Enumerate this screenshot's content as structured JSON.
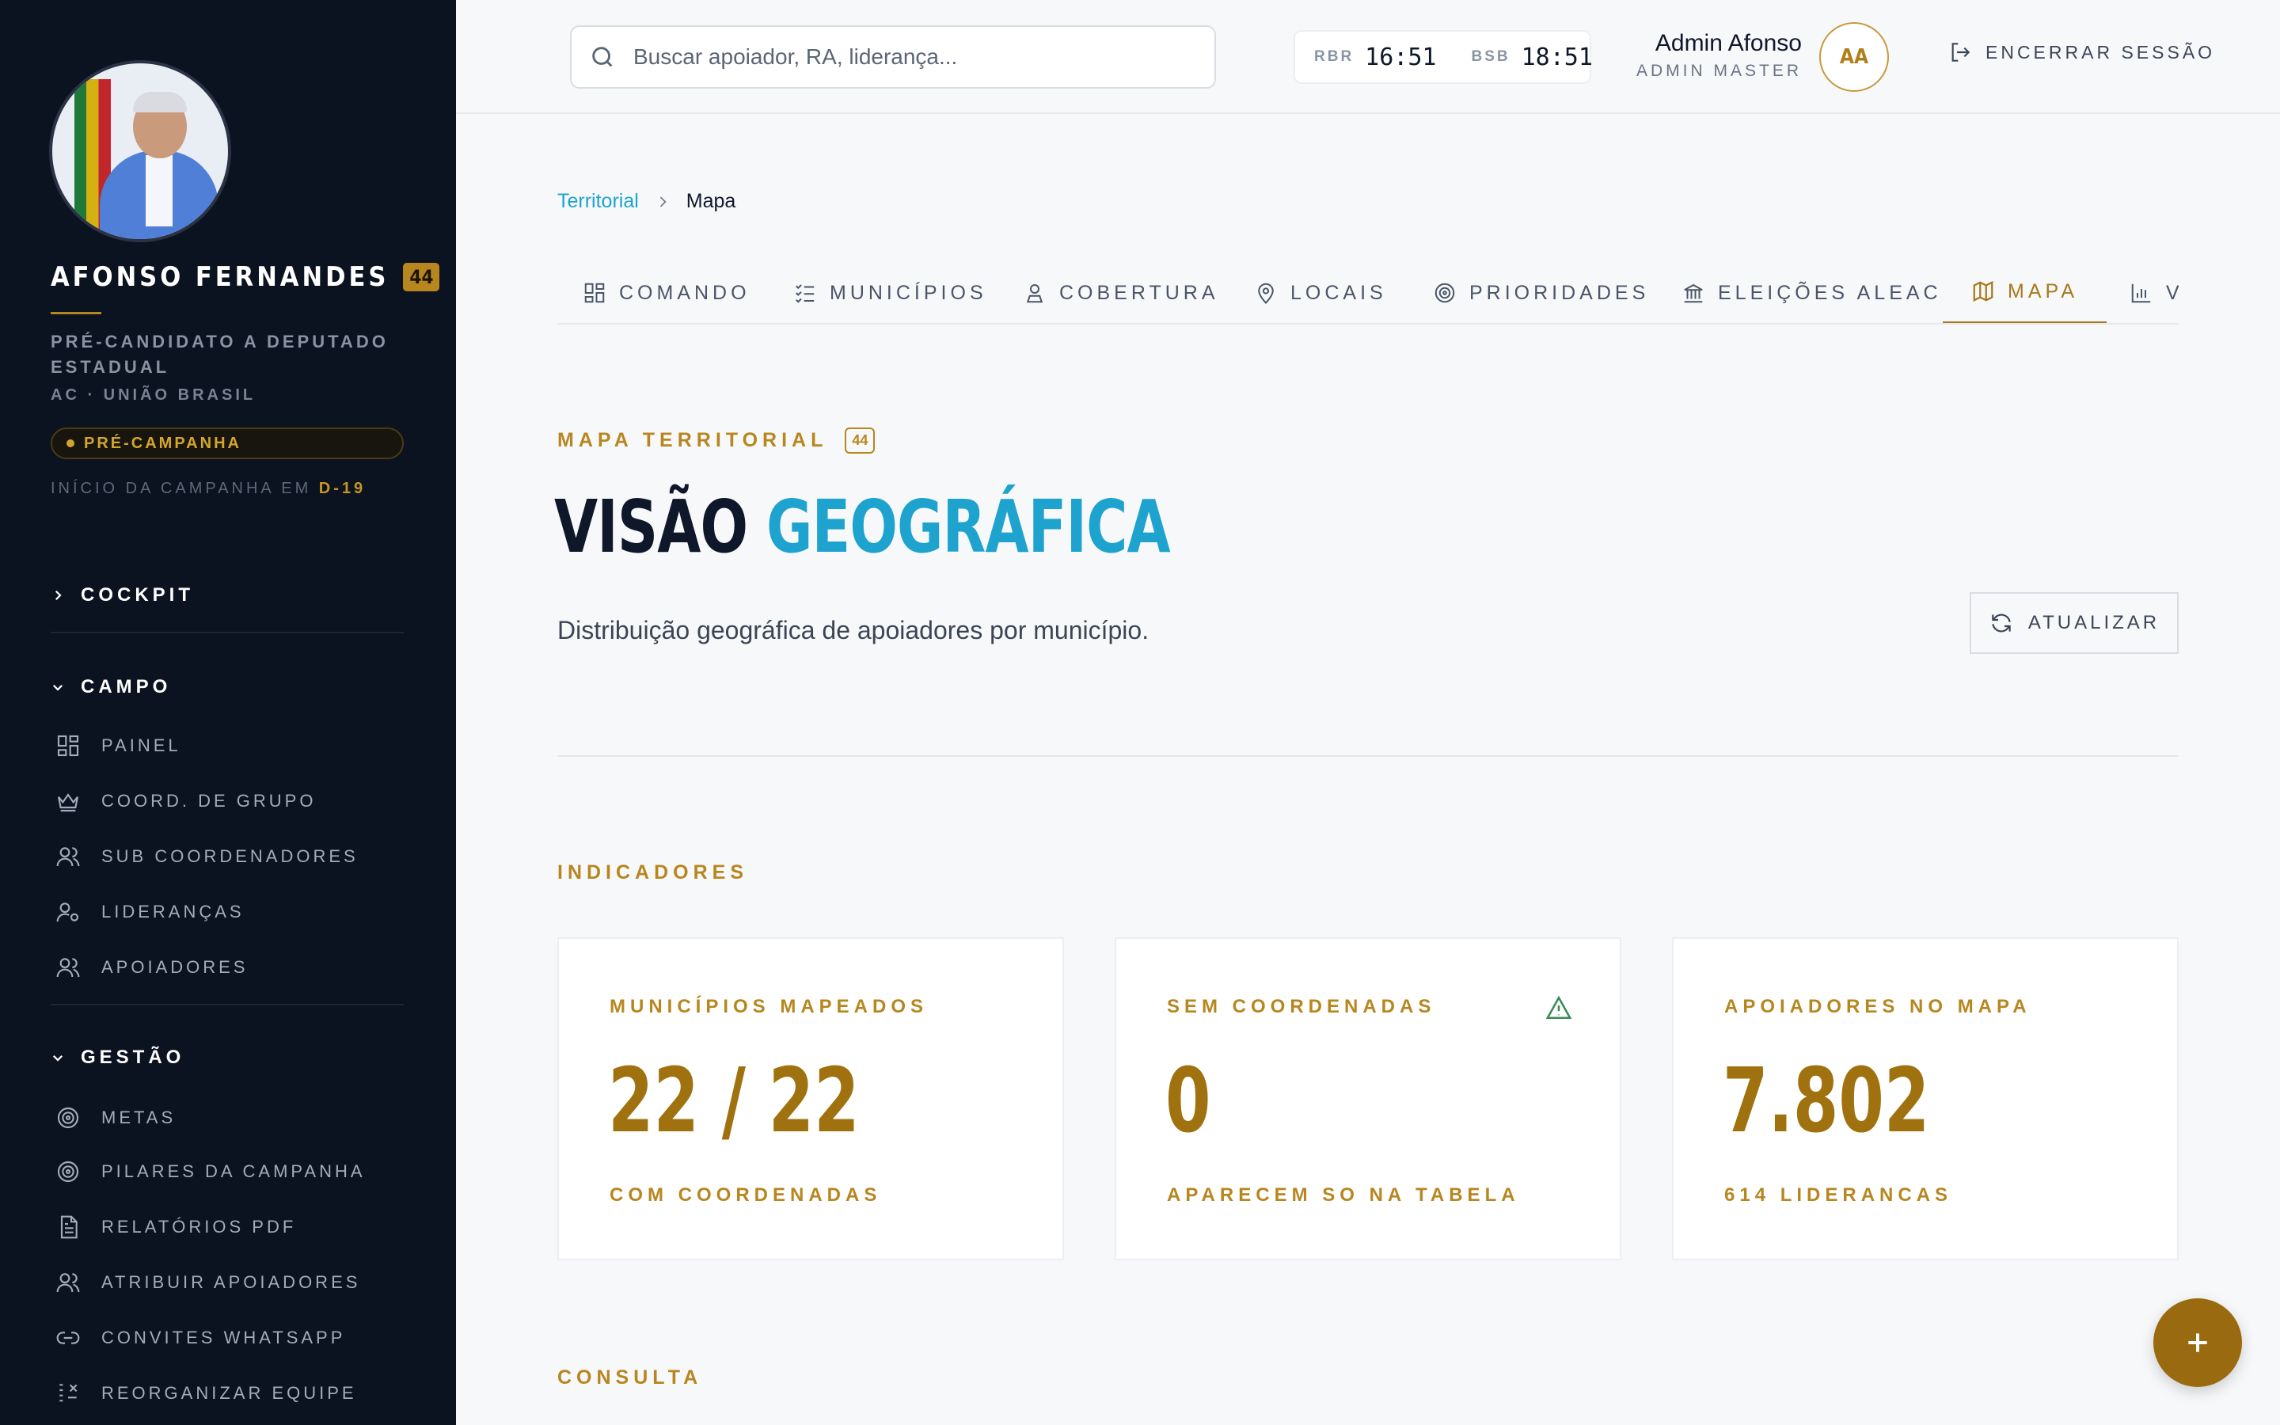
{
  "sidebar": {
    "candidate_name": "AFONSO FERNANDES",
    "candidate_number": "44",
    "role": "PRÉ-CANDIDATO A DEPUTADO ESTADUAL",
    "party": "AC · UNIÃO BRASIL",
    "phase": "PRÉ-CAMPANHA",
    "countdown_label": "INÍCIO DA CAMPANHA EM",
    "countdown_value": "D-19",
    "sections": {
      "cockpit": "COCKPIT",
      "campo": "CAMPO",
      "gestao": "GESTÃO"
    },
    "campo_items": [
      {
        "label": "PAINEL",
        "icon": "grid-icon"
      },
      {
        "label": "COORD. DE GRUPO",
        "icon": "crown-icon"
      },
      {
        "label": "SUB COORDENADORES",
        "icon": "users-icon"
      },
      {
        "label": "LIDERANÇAS",
        "icon": "user-cog-icon"
      },
      {
        "label": "APOIADORES",
        "icon": "users-icon"
      }
    ],
    "gestao_items": [
      {
        "label": "METAS",
        "icon": "target-icon"
      },
      {
        "label": "PILARES DA CAMPANHA",
        "icon": "target-icon"
      },
      {
        "label": "RELATÓRIOS PDF",
        "icon": "file-text-icon"
      },
      {
        "label": "ATRIBUIR APOIADORES",
        "icon": "users-icon"
      },
      {
        "label": "CONVITES WHATSAPP",
        "icon": "link-icon"
      },
      {
        "label": "REORGANIZAR EQUIPE",
        "icon": "drag-icon"
      }
    ]
  },
  "topbar": {
    "search_placeholder": "Buscar apoiador, RA, liderança...",
    "clock1_label": "RBR",
    "clock1_time": "16:51",
    "clock2_label": "BSB",
    "clock2_time": "18:51",
    "user_name": "Admin Afonso",
    "user_role": "ADMIN MASTER",
    "user_initials": "AA",
    "logout_label": "ENCERRAR SESSÃO"
  },
  "breadcrumb": {
    "parent": "Territorial",
    "current": "Mapa"
  },
  "tabs": [
    {
      "label": "COMANDO",
      "icon": "grid-icon",
      "active": false
    },
    {
      "label": "MUNICÍPIOS",
      "icon": "list-check-icon",
      "active": false
    },
    {
      "label": "COBERTURA",
      "icon": "map-user-icon",
      "active": false
    },
    {
      "label": "LOCAIS",
      "icon": "map-pin-icon",
      "active": false
    },
    {
      "label": "PRIORIDADES",
      "icon": "target-icon",
      "active": false
    },
    {
      "label": "ELEIÇÕES ALEAC",
      "icon": "landmark-icon",
      "active": false
    },
    {
      "label": "MAPA",
      "icon": "map-icon",
      "active": true
    },
    {
      "label": "V",
      "icon": "bar-chart-icon",
      "active": false
    }
  ],
  "page": {
    "eyebrow": "MAPA TERRITORIAL",
    "eyebrow_badge": "44",
    "title_dark": "VISÃO",
    "title_accent": "GEOGRÁFICA",
    "subtitle": "Distribuição geográfica de apoiadores por município.",
    "refresh_label": "ATUALIZAR",
    "indicators_label": "INDICADORES",
    "consulta_label": "CONSULTA"
  },
  "cards": [
    {
      "title": "MUNICÍPIOS MAPEADOS",
      "value": "22 / 22",
      "sub": "COM COORDENADAS"
    },
    {
      "title": "SEM COORDENADAS",
      "value": "0",
      "sub": "APARECEM SO NA TABELA"
    },
    {
      "title": "APOIADORES NO MAPA",
      "value": "7.802",
      "sub": "614 LIDERANCAS"
    }
  ],
  "colors": {
    "sidebar_bg": "#0b1220",
    "gold": "#b8861f",
    "accent_blue": "#1ea3cf",
    "fab": "#9a6a10"
  }
}
